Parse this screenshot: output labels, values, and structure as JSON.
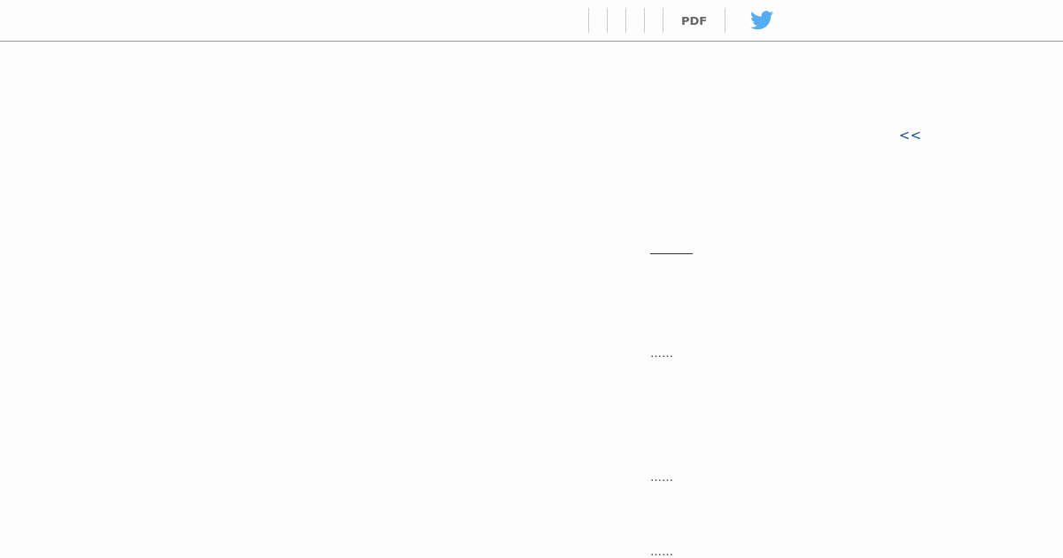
{
  "toolbar": {
    "pdf_label": "PDF"
  },
  "back_link": "<<",
  "ellipses": [
    "……",
    "……",
    "……"
  ]
}
